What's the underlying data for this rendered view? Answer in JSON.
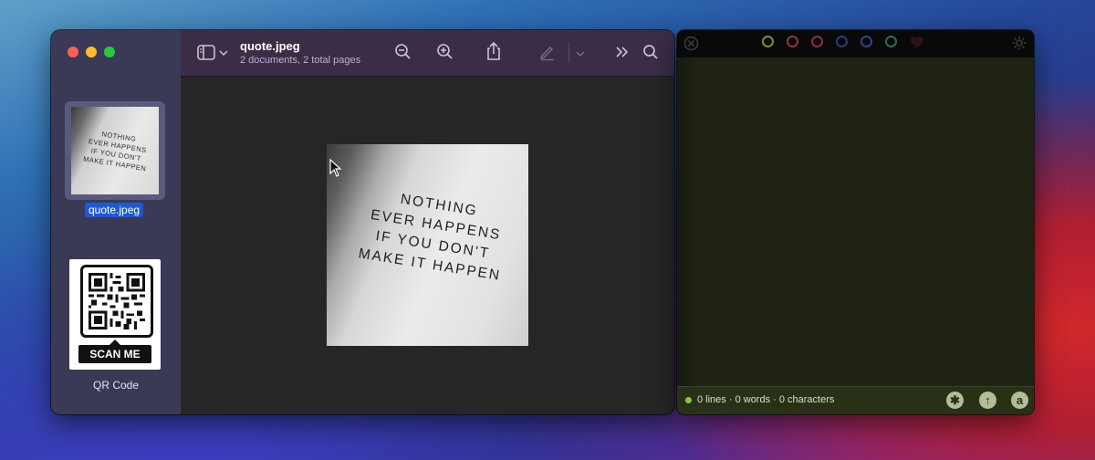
{
  "preview": {
    "doc_title": "quote.jpeg",
    "doc_subtitle": "2 documents, 2 total pages",
    "thumbnails": [
      {
        "label": "quote.jpeg",
        "image_text": [
          "NOTHING",
          "EVER HAPPENS",
          "IF YOU DON'T",
          "MAKE IT HAPPEN"
        ]
      },
      {
        "label": "QR Code",
        "tag_text": "SCAN ME"
      }
    ],
    "photo_text": [
      "NOTHING",
      "EVER HAPPENS",
      "IF YOU DON'T",
      "MAKE IT HAPPEN"
    ],
    "toolbar_icons": [
      "sidebar-icon",
      "chevron-down-icon",
      "zoom-out-icon",
      "zoom-in-icon",
      "share-icon",
      "markup-pen-icon",
      "chevron-down-icon",
      "more-icon",
      "search-icon"
    ]
  },
  "editor": {
    "status_text": "0 lines · 0 words · 0 characters",
    "ring_colors": [
      "#8a8a2a",
      "#8a3b3b",
      "#8a2f44",
      "#2f3a78",
      "#33418a",
      "#2f6a5a"
    ],
    "accent": "#8ac442",
    "footer_icons": [
      "asterisk-icon",
      "arrow-up-icon",
      "at-icon"
    ]
  }
}
